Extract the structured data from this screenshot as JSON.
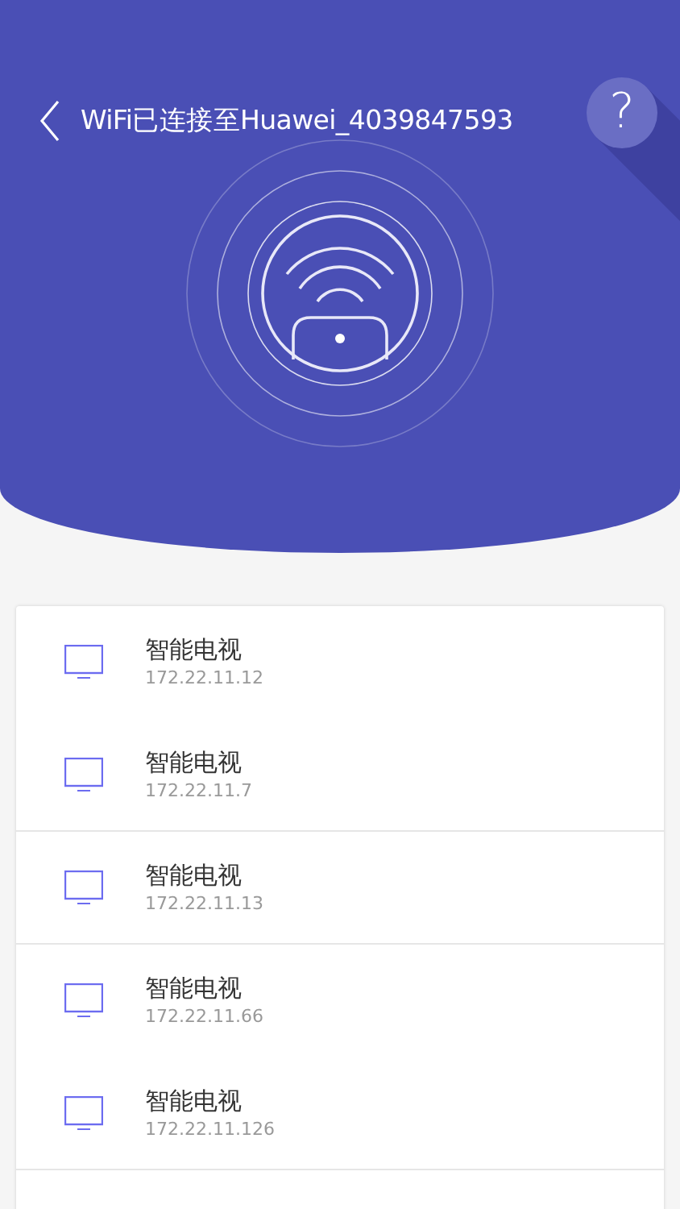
{
  "header": {
    "title": "WiFi已连接至Huawei_4039847593",
    "help": "?"
  },
  "devices": [
    {
      "name": "智能电视",
      "ip": "172.22.11.12",
      "divider_below": false
    },
    {
      "name": "智能电视",
      "ip": "172.22.11.7",
      "divider_below": true
    },
    {
      "name": "智能电视",
      "ip": "172.22.11.13",
      "divider_below": true
    },
    {
      "name": "智能电视",
      "ip": "172.22.11.66",
      "divider_below": false
    },
    {
      "name": "智能电视",
      "ip": "172.22.11.126",
      "divider_below": true
    }
  ]
}
